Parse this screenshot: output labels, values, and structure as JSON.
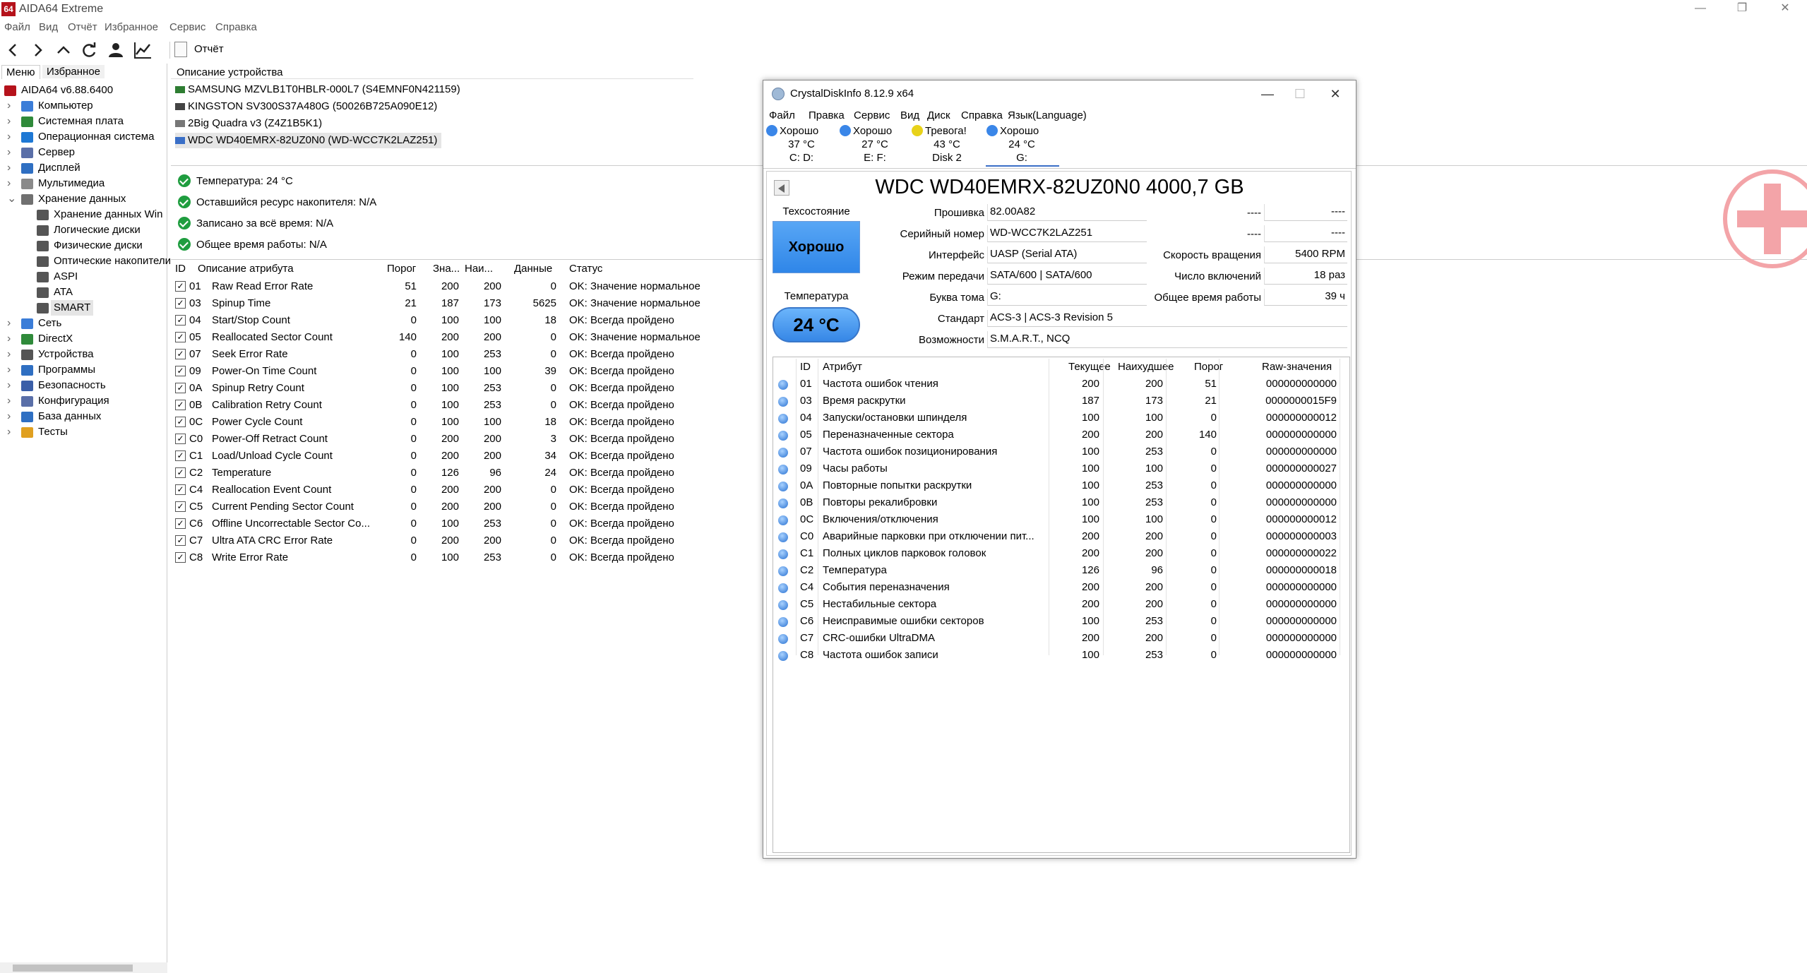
{
  "app": {
    "icon_text": "64",
    "title": "AIDA64 Extreme",
    "menu": [
      "Файл",
      "Вид",
      "Отчёт",
      "Избранное",
      "Сервис",
      "Справка"
    ],
    "toolbar_report": "Отчёт",
    "tabs": [
      "Меню",
      "Избранное"
    ]
  },
  "tree": [
    {
      "label": "AIDA64 v6.88.6400",
      "level": 0,
      "arrow": "",
      "icon": "aida-icon",
      "color": "#b5121b"
    },
    {
      "label": "Компьютер",
      "level": 1,
      "arrow": ">",
      "icon": "computer-icon",
      "color": "#3b7dd8"
    },
    {
      "label": "Системная плата",
      "level": 1,
      "arrow": ">",
      "icon": "motherboard-icon",
      "color": "#2f8a3a"
    },
    {
      "label": "Операционная система",
      "level": 1,
      "arrow": ">",
      "icon": "windows-icon",
      "color": "#1e78d4"
    },
    {
      "label": "Сервер",
      "level": 1,
      "arrow": ">",
      "icon": "server-icon",
      "color": "#5a6fa8"
    },
    {
      "label": "Дисплей",
      "level": 1,
      "arrow": ">",
      "icon": "display-icon",
      "color": "#2f6fc2"
    },
    {
      "label": "Мультимедиа",
      "level": 1,
      "arrow": ">",
      "icon": "multimedia-icon",
      "color": "#8a8a8a"
    },
    {
      "label": "Хранение данных",
      "level": 1,
      "arrow": "v",
      "icon": "storage-icon",
      "color": "#707070"
    },
    {
      "label": "Хранение данных Win",
      "level": 2,
      "arrow": "",
      "icon": "storage-win-icon",
      "color": "#555"
    },
    {
      "label": "Логические диски",
      "level": 2,
      "arrow": "",
      "icon": "logical-disk-icon",
      "color": "#555"
    },
    {
      "label": "Физические диски",
      "level": 2,
      "arrow": "",
      "icon": "physical-disk-icon",
      "color": "#555"
    },
    {
      "label": "Оптические накопители",
      "level": 2,
      "arrow": "",
      "icon": "optical-drive-icon",
      "color": "#555"
    },
    {
      "label": "ASPI",
      "level": 2,
      "arrow": "",
      "icon": "aspi-icon",
      "color": "#555"
    },
    {
      "label": "ATA",
      "level": 2,
      "arrow": "",
      "icon": "ata-icon",
      "color": "#555"
    },
    {
      "label": "SMART",
      "level": 2,
      "arrow": "",
      "icon": "smart-icon",
      "color": "#555",
      "selected": true
    },
    {
      "label": "Сеть",
      "level": 1,
      "arrow": ">",
      "icon": "network-icon",
      "color": "#3b7dd8"
    },
    {
      "label": "DirectX",
      "level": 1,
      "arrow": ">",
      "icon": "directx-icon",
      "color": "#2f8a3a"
    },
    {
      "label": "Устройства",
      "level": 1,
      "arrow": ">",
      "icon": "devices-icon",
      "color": "#555"
    },
    {
      "label": "Программы",
      "level": 1,
      "arrow": ">",
      "icon": "programs-icon",
      "color": "#2f6fc2"
    },
    {
      "label": "Безопасность",
      "level": 1,
      "arrow": ">",
      "icon": "security-icon",
      "color": "#3b5fa8"
    },
    {
      "label": "Конфигурация",
      "level": 1,
      "arrow": ">",
      "icon": "configuration-icon",
      "color": "#5a6fa8"
    },
    {
      "label": "База данных",
      "level": 1,
      "arrow": ">",
      "icon": "database-icon",
      "color": "#2f6fc2"
    },
    {
      "label": "Тесты",
      "level": 1,
      "arrow": ">",
      "icon": "tests-icon",
      "color": "#e0a020"
    }
  ],
  "devices": {
    "header": "Описание устройства",
    "items": [
      "SAMSUNG MZVLB1T0HBLR-000L7 (S4EMNF0N421159)",
      "KINGSTON SV300S37A480G (50026B725A090E12)",
      "2Big Quadra v3 (Z4Z1B5K1)",
      "WDC WD40EMRX-82UZ0N0 (WD-WCC7K2LAZ251)"
    ]
  },
  "status": [
    "Температура: 24 °C",
    "Оставшийся ресурс накопителя: N/A",
    "Записано за всё время: N/A",
    "Общее время работы: N/A"
  ],
  "smart": {
    "headers": [
      "ID",
      "Описание атрибута",
      "Порог",
      "Зна...",
      "Наи...",
      "Данные",
      "Статус"
    ],
    "rows": [
      [
        "01",
        "Raw Read Error Rate",
        "51",
        "200",
        "200",
        "0",
        "OK: Значение нормальное"
      ],
      [
        "03",
        "Spinup Time",
        "21",
        "187",
        "173",
        "5625",
        "OK: Значение нормальное"
      ],
      [
        "04",
        "Start/Stop Count",
        "0",
        "100",
        "100",
        "18",
        "OK: Всегда пройдено"
      ],
      [
        "05",
        "Reallocated Sector Count",
        "140",
        "200",
        "200",
        "0",
        "OK: Значение нормальное"
      ],
      [
        "07",
        "Seek Error Rate",
        "0",
        "100",
        "253",
        "0",
        "OK: Всегда пройдено"
      ],
      [
        "09",
        "Power-On Time Count",
        "0",
        "100",
        "100",
        "39",
        "OK: Всегда пройдено"
      ],
      [
        "0A",
        "Spinup Retry Count",
        "0",
        "100",
        "253",
        "0",
        "OK: Всегда пройдено"
      ],
      [
        "0B",
        "Calibration Retry Count",
        "0",
        "100",
        "253",
        "0",
        "OK: Всегда пройдено"
      ],
      [
        "0C",
        "Power Cycle Count",
        "0",
        "100",
        "100",
        "18",
        "OK: Всегда пройдено"
      ],
      [
        "C0",
        "Power-Off Retract Count",
        "0",
        "200",
        "200",
        "3",
        "OK: Всегда пройдено"
      ],
      [
        "C1",
        "Load/Unload Cycle Count",
        "0",
        "200",
        "200",
        "34",
        "OK: Всегда пройдено"
      ],
      [
        "C2",
        "Temperature",
        "0",
        "126",
        "96",
        "24",
        "OK: Всегда пройдено"
      ],
      [
        "C4",
        "Reallocation Event Count",
        "0",
        "200",
        "200",
        "0",
        "OK: Всегда пройдено"
      ],
      [
        "C5",
        "Current Pending Sector Count",
        "0",
        "200",
        "200",
        "0",
        "OK: Всегда пройдено"
      ],
      [
        "C6",
        "Offline Uncorrectable Sector Co...",
        "0",
        "100",
        "253",
        "0",
        "OK: Всегда пройдено"
      ],
      [
        "C7",
        "Ultra ATA CRC Error Rate",
        "0",
        "200",
        "200",
        "0",
        "OK: Всегда пройдено"
      ],
      [
        "C8",
        "Write Error Rate",
        "0",
        "100",
        "253",
        "0",
        "OK: Всегда пройдено"
      ]
    ]
  },
  "cdi": {
    "title": "CrystalDiskInfo 8.12.9 x64",
    "menu": [
      "Файл",
      "Правка",
      "Сервис",
      "Вид",
      "Диск",
      "Справка",
      "Язык(Language)"
    ],
    "disks": [
      {
        "status": "Хорошо",
        "temp": "37 °C",
        "drive": "C: D:",
        "color": "#3a86e8"
      },
      {
        "status": "Хорошо",
        "temp": "27 °C",
        "drive": "E: F:",
        "color": "#3a86e8"
      },
      {
        "status": "Тревога!",
        "temp": "43 °C",
        "drive": "Disk 2",
        "color": "#e8d21a"
      },
      {
        "status": "Хорошо",
        "temp": "24 °C",
        "drive": "G:",
        "color": "#3a86e8"
      }
    ],
    "disk_name": "WDC WD40EMRX-82UZ0N0 4000,7 GB",
    "health_label": "Техсостояние",
    "health_value": "Хорошо",
    "temp_label": "Температура",
    "temp_value": "24 °C",
    "fields": {
      "firmware_label": "Прошивка",
      "firmware": "82.00A82",
      "serial_label": "Серийный номер",
      "serial": "WD-WCC7K2LAZ251",
      "interface_label": "Интерфейс",
      "interface": "UASP (Serial ATA)",
      "transfer_label": "Режим передачи",
      "transfer": "SATA/600 | SATA/600",
      "letter_label": "Буква тома",
      "letter": "G:",
      "standard_label": "Стандарт",
      "standard": "ACS-3 | ACS-3 Revision 5",
      "features_label": "Возможности",
      "features": "S.M.A.R.T., NCQ",
      "blank1_label": "----",
      "blank1": "----",
      "blank2_label": "----",
      "blank2": "----",
      "rpm_label": "Скорость вращения",
      "rpm": "5400 RPM",
      "power_count_label": "Число включений",
      "power_count": "18 раз",
      "power_hours_label": "Общее время работы",
      "power_hours": "39 ч"
    },
    "attr_headers": [
      "ID",
      "Атрибут",
      "Текущее",
      "Наихудшее",
      "Порог",
      "Raw-значения"
    ],
    "attrs": [
      [
        "01",
        "Частота ошибок чтения",
        "200",
        "200",
        "51",
        "000000000000"
      ],
      [
        "03",
        "Время раскрутки",
        "187",
        "173",
        "21",
        "0000000015F9"
      ],
      [
        "04",
        "Запуски/остановки шпинделя",
        "100",
        "100",
        "0",
        "000000000012"
      ],
      [
        "05",
        "Переназначенные сектора",
        "200",
        "200",
        "140",
        "000000000000"
      ],
      [
        "07",
        "Частота ошибок позиционирования",
        "100",
        "253",
        "0",
        "000000000000"
      ],
      [
        "09",
        "Часы работы",
        "100",
        "100",
        "0",
        "000000000027"
      ],
      [
        "0A",
        "Повторные попытки раскрутки",
        "100",
        "253",
        "0",
        "000000000000"
      ],
      [
        "0B",
        "Повторы рекалибровки",
        "100",
        "253",
        "0",
        "000000000000"
      ],
      [
        "0C",
        "Включения/отключения",
        "100",
        "100",
        "0",
        "000000000012"
      ],
      [
        "C0",
        "Аварийные парковки при отключении пит...",
        "200",
        "200",
        "0",
        "000000000003"
      ],
      [
        "C1",
        "Полных циклов парковок головок",
        "200",
        "200",
        "0",
        "000000000022"
      ],
      [
        "C2",
        "Температура",
        "126",
        "96",
        "0",
        "000000000018"
      ],
      [
        "C4",
        "События переназначения",
        "200",
        "200",
        "0",
        "000000000000"
      ],
      [
        "C5",
        "Нестабильные сектора",
        "200",
        "200",
        "0",
        "000000000000"
      ],
      [
        "C6",
        "Неисправимые ошибки секторов",
        "100",
        "253",
        "0",
        "000000000000"
      ],
      [
        "C7",
        "CRC-ошибки UltraDMA",
        "200",
        "200",
        "0",
        "000000000000"
      ],
      [
        "C8",
        "Частота ошибок записи",
        "100",
        "253",
        "0",
        "000000000000"
      ]
    ]
  }
}
